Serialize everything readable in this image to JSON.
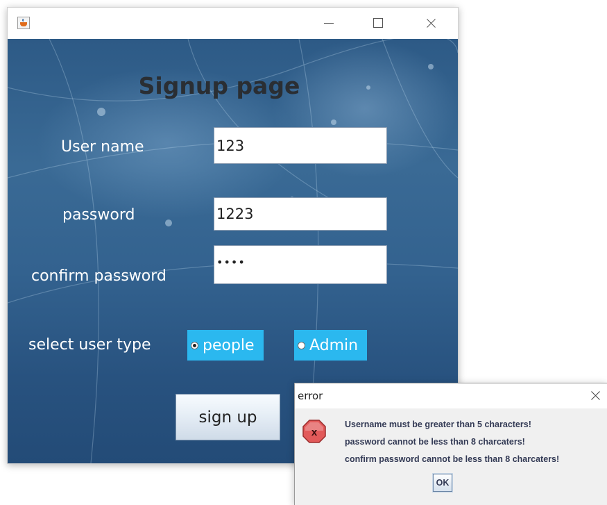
{
  "window": {
    "icon": "java-cup-icon",
    "controls": [
      "minimize-icon",
      "maximize-icon",
      "close-icon"
    ]
  },
  "form": {
    "heading": "Signup page",
    "username_label": "User name",
    "username_value": "123",
    "password_label": "password",
    "password_value": "1223",
    "confirm_label": "confirm password",
    "confirm_value": "••••",
    "user_type_label": "select user type",
    "options": [
      {
        "label": "people",
        "selected": true
      },
      {
        "label": "Admin",
        "selected": false
      }
    ],
    "signup_label": "sign up"
  },
  "dialog": {
    "title": "error",
    "icon": "error-x-icon",
    "messages": [
      "Username must be greater than 5 characters!",
      "password cannot be less than 8 charcaters!",
      "confirm password cannot be less than 8 charcaters!"
    ],
    "ok_label": "OK"
  },
  "colors": {
    "background_top": "#2d5a86",
    "background_bottom": "#234b77",
    "radio_highlight": "#2bb8ef",
    "error_icon": "#e25a5a"
  }
}
